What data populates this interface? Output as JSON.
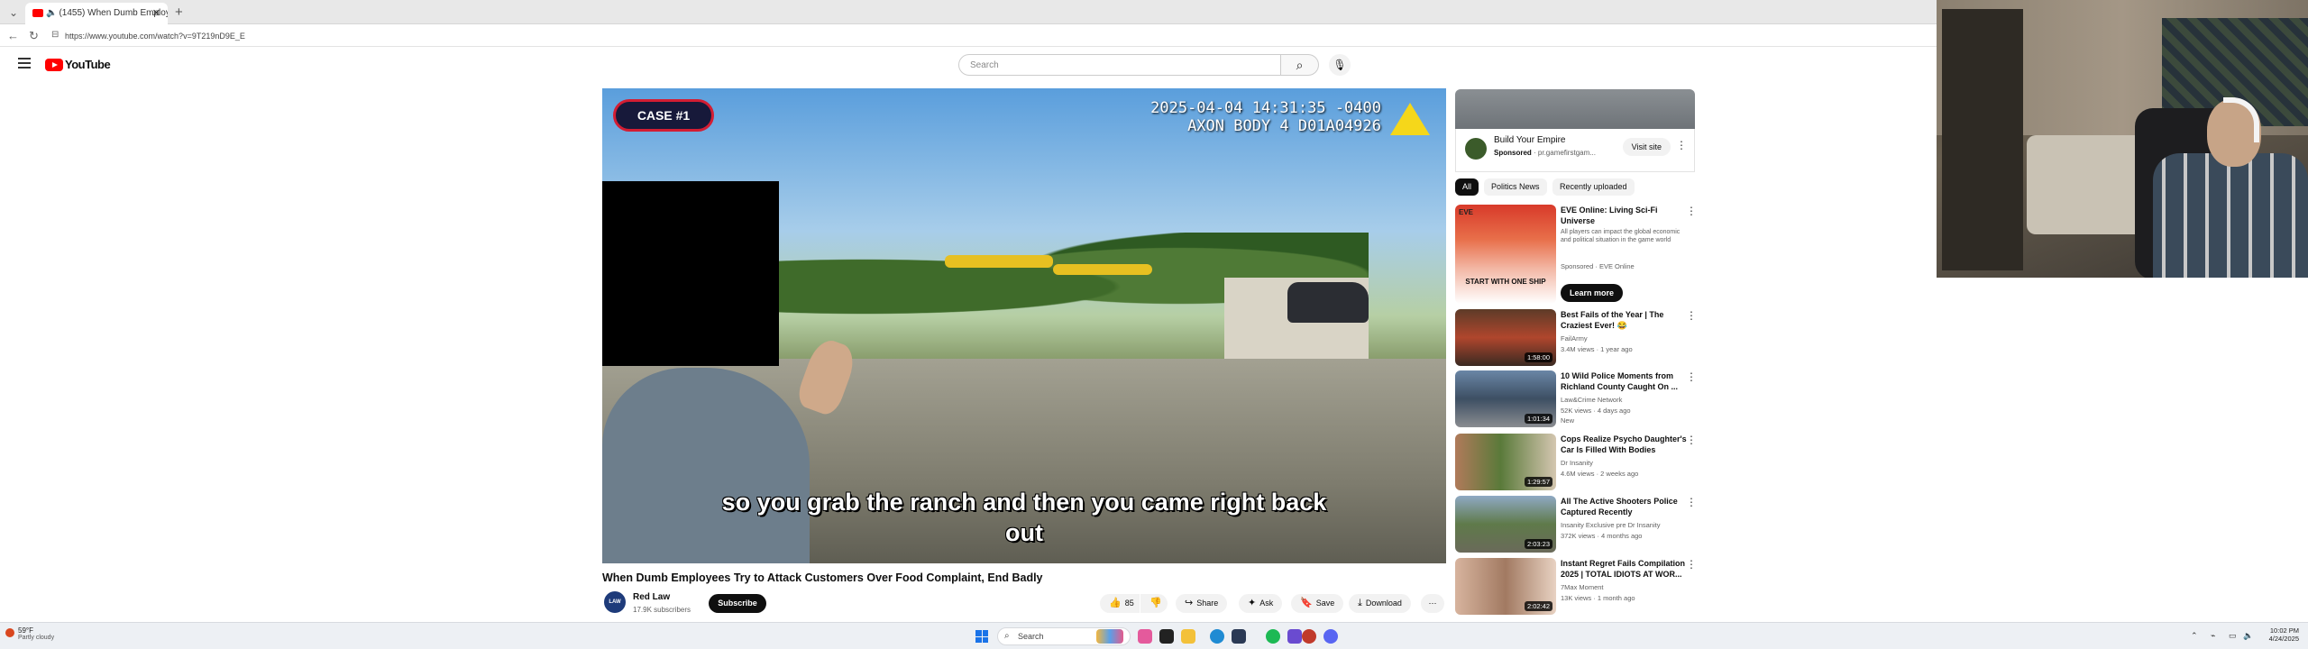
{
  "browser": {
    "tab_title": "(1455) When Dumb Employe",
    "url": "https://www.youtube.com/watch?v=9T219nD9E_E"
  },
  "youtube": {
    "logo_text": "YouTube",
    "search_placeholder": "Search"
  },
  "video": {
    "case_badge": "CASE #1",
    "timestamp_line1": "2025-04-04 14:31:35 -0400",
    "timestamp_line2": "AXON BODY 4 D01A04926",
    "subtitle_line1": "so you grab the ranch and then you came right back",
    "subtitle_line2": "out",
    "title": "When Dumb Employees Try to Attack Customers Over Food Complaint, End Badly"
  },
  "channel": {
    "avatar_text": "LAW",
    "name": "Red Law",
    "subscribers": "17.9K subscribers",
    "subscribe_label": "Subscribe"
  },
  "actions": {
    "like_count": "85",
    "share_label": "Share",
    "ask_label": "Ask",
    "save_label": "Save",
    "download_label": "Download"
  },
  "ad": {
    "title": "Build Your Empire",
    "sponsored": "Sponsored",
    "domain": "· pr.gamefirstgam...",
    "visit_label": "Visit site"
  },
  "chips": [
    "All",
    "Politics News",
    "Recently uploaded"
  ],
  "recommendations": [
    {
      "title": "EVE Online: Living Sci-Fi Universe",
      "description": "All players can impact the global economic and political situation in the game world",
      "channel": "Sponsored · EVE Online",
      "thumb_text": "START WITH ONE SHIP",
      "cta": "Learn more"
    },
    {
      "title": "Best Fails of the Year | The Craziest Ever! 😂",
      "channel": "FailArmy",
      "views": "3.4M views · 1 year ago",
      "duration": "1:58:00"
    },
    {
      "title": "10 Wild Police Moments from Richland County Caught On ...",
      "channel": "Law&Crime Network",
      "views": "52K views · 4 days ago",
      "badge": "New",
      "duration": "1:01:34"
    },
    {
      "title": "Cops Realize Psycho Daughter's Car Is Filled With Bodies",
      "channel": "Dr Insanity",
      "views": "4.6M views · 2 weeks ago",
      "duration": "1:29:57"
    },
    {
      "title": "All The Active Shooters Police Captured Recently",
      "channel": "Insanity Exclusive pre Dr Insanity",
      "views": "372K views · 4 months ago",
      "duration": "2:03:23"
    },
    {
      "title": "Instant Regret Fails Compilation 2025 | TOTAL IDIOTS AT WOR...",
      "channel": "7Max Moment",
      "views": "13K views · 1 month ago",
      "duration": "2:02:42"
    }
  ],
  "taskbar": {
    "temperature": "59°F",
    "condition": "Partly cloudy",
    "search_label": "Search",
    "time": "10:02 PM",
    "date": "4/24/2025"
  },
  "colors": {
    "youtube_red": "#ff0000",
    "case_badge_border": "#d31d33",
    "subscribe_bg": "#0f0f0f"
  }
}
